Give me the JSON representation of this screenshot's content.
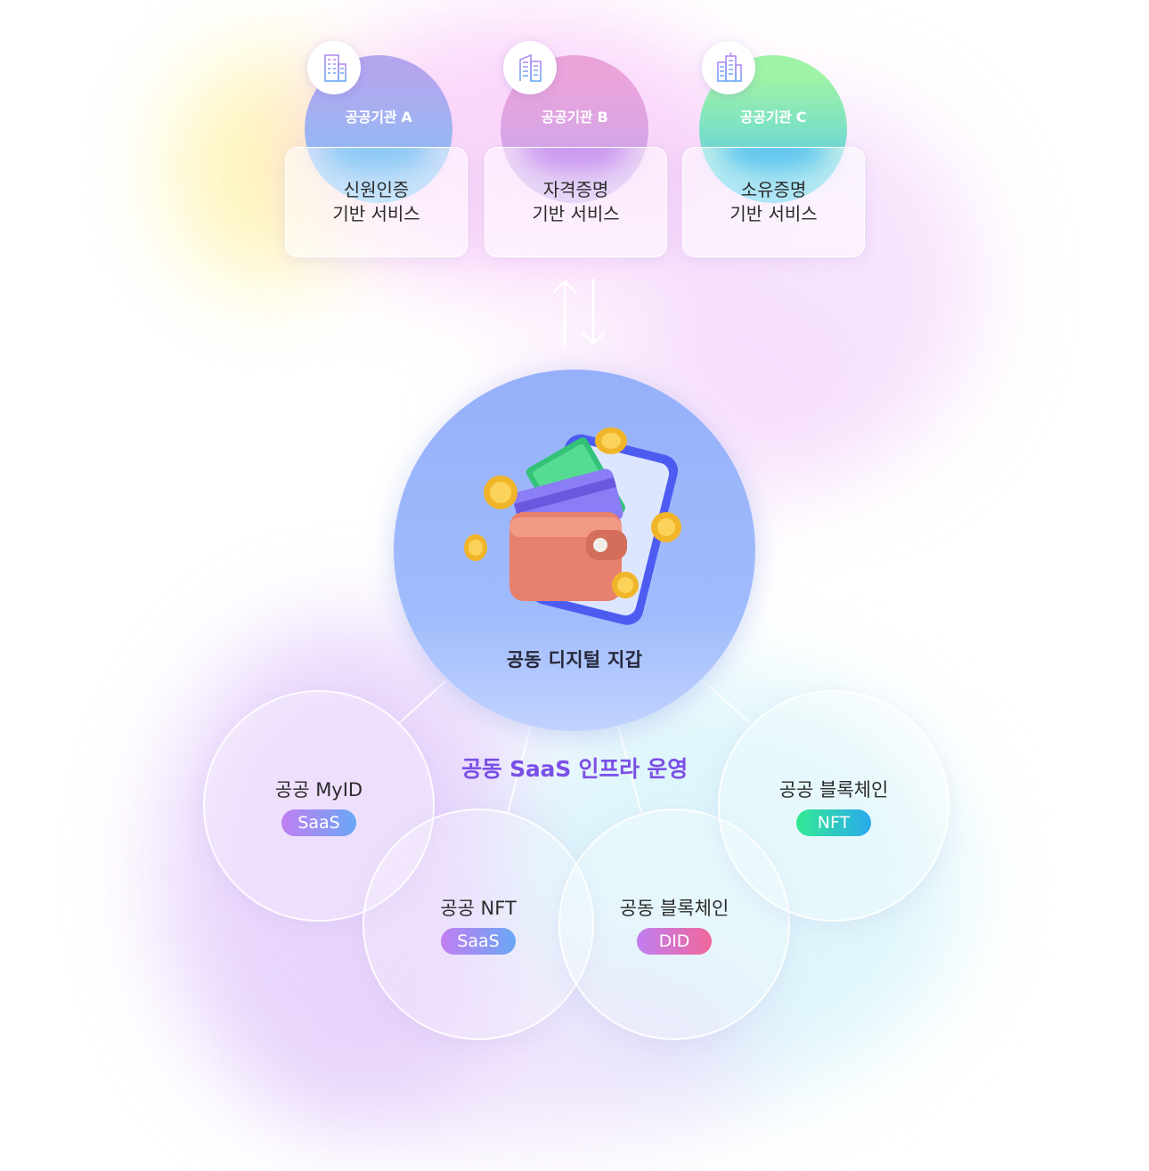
{
  "agencies": [
    {
      "label": "공공기관 A",
      "icon": "building-icon",
      "service_line1": "신원인증",
      "service_line2": "기반 서비스"
    },
    {
      "label": "공공기관 B",
      "icon": "building-icon",
      "service_line1": "자격증명",
      "service_line2": "기반 서비스"
    },
    {
      "label": "공공기관 C",
      "icon": "building-icon",
      "service_line1": "소유증명",
      "service_line2": "기반 서비스"
    }
  ],
  "exchange_icon": "up-down-arrows-icon",
  "hub": {
    "title": "공동 디지털 지갑",
    "icon": "wallet-icon"
  },
  "infra_label": "공동 SaaS 인프라 운영",
  "services": [
    {
      "name": "공공 MyID",
      "tag": "SaaS"
    },
    {
      "name": "공공 NFT",
      "tag": "SaaS"
    },
    {
      "name": "공동 블록체인",
      "tag": "DID"
    },
    {
      "name": "공공 블록체인",
      "tag": "NFT"
    }
  ],
  "colors": {
    "agency_a": "#a99ff0",
    "agency_b": "#e6a4dc",
    "agency_c": "#7fe9b3",
    "hub": "#9bb5fb",
    "infra_text": "#7a4fe6",
    "pill_saas": "#9a8ff3",
    "pill_nft": "#2fd0bd",
    "pill_did": "#d472c3"
  }
}
